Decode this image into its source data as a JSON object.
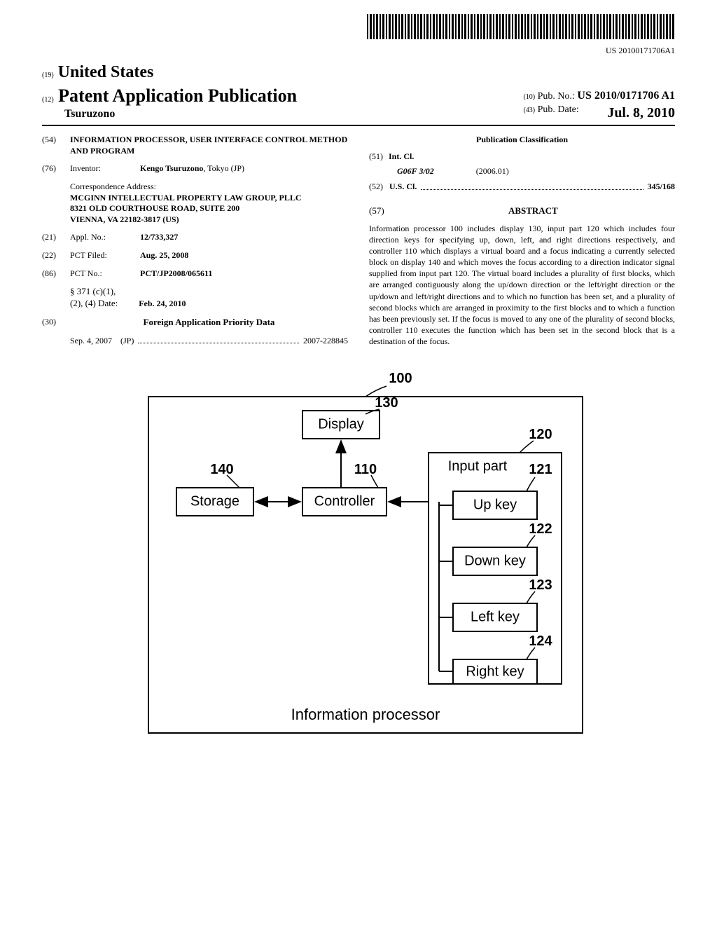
{
  "barcode_number": "US 20100171706A1",
  "header": {
    "country_code": "(19)",
    "country": "United States",
    "pub_type_code": "(12)",
    "pub_type": "Patent Application Publication",
    "authors": "Tsuruzono",
    "pub_no_code": "(10)",
    "pub_no_label": "Pub. No.:",
    "pub_no": "US 2010/0171706 A1",
    "pub_date_code": "(43)",
    "pub_date_label": "Pub. Date:",
    "pub_date": "Jul. 8, 2010"
  },
  "fields": {
    "title_code": "(54)",
    "title": "INFORMATION PROCESSOR, USER INTERFACE CONTROL METHOD AND PROGRAM",
    "inventor_code": "(76)",
    "inventor_label": "Inventor:",
    "inventor": "Kengo Tsuruzono",
    "inventor_loc": ", Tokyo (JP)",
    "corr_label": "Correspondence Address:",
    "corr_name": "MCGINN INTELLECTUAL PROPERTY LAW GROUP, PLLC",
    "corr_addr1": "8321 OLD COURTHOUSE ROAD, SUITE 200",
    "corr_addr2": "VIENNA, VA 22182-3817 (US)",
    "appl_no_code": "(21)",
    "appl_no_label": "Appl. No.:",
    "appl_no": "12/733,327",
    "pct_filed_code": "(22)",
    "pct_filed_label": "PCT Filed:",
    "pct_filed": "Aug. 25, 2008",
    "pct_no_code": "(86)",
    "pct_no_label": "PCT No.:",
    "pct_no": "PCT/JP2008/065611",
    "s371_label": "§ 371 (c)(1),",
    "s371_date_label": "(2), (4) Date:",
    "s371_date": "Feb. 24, 2010",
    "foreign_code": "(30)",
    "foreign_header": "Foreign Application Priority Data",
    "foreign_date": "Sep. 4, 2007",
    "foreign_country": "(JP)",
    "foreign_no": "2007-228845"
  },
  "classification": {
    "header": "Publication Classification",
    "intcl_code": "(51)",
    "intcl_label": "Int. Cl.",
    "intcl_class": "G06F 3/02",
    "intcl_date": "(2006.01)",
    "uscl_code": "(52)",
    "uscl_label": "U.S. Cl.",
    "uscl_class": "345/168"
  },
  "abstract": {
    "code": "(57)",
    "header": "ABSTRACT",
    "text": "Information processor 100 includes display 130, input part 120 which includes four direction keys for specifying up, down, left, and right directions respectively, and controller 110 which displays a virtual board and a focus indicating a currently selected block on display 140 and which moves the focus according to a direction indicator signal supplied from input part 120. The virtual board includes a plurality of first blocks, which are arranged contiguously along the up/down direction or the left/right direction or the up/down and left/right directions and to which no function has been set, and a plurality of second blocks which are arranged in proximity to the first blocks and to which a function has been previously set. If the focus is moved to any one of the plurality of second blocks, controller 110 executes the function which has been set in the second block that is a destination of the focus."
  },
  "figure": {
    "ref_100": "100",
    "ref_130": "130",
    "ref_120": "120",
    "ref_140": "140",
    "ref_110": "110",
    "ref_121": "121",
    "ref_122": "122",
    "ref_123": "123",
    "ref_124": "124",
    "display": "Display",
    "input_part": "Input part",
    "storage": "Storage",
    "controller": "Controller",
    "up_key": "Up key",
    "down_key": "Down key",
    "left_key": "Left key",
    "right_key": "Right key",
    "caption": "Information processor"
  }
}
